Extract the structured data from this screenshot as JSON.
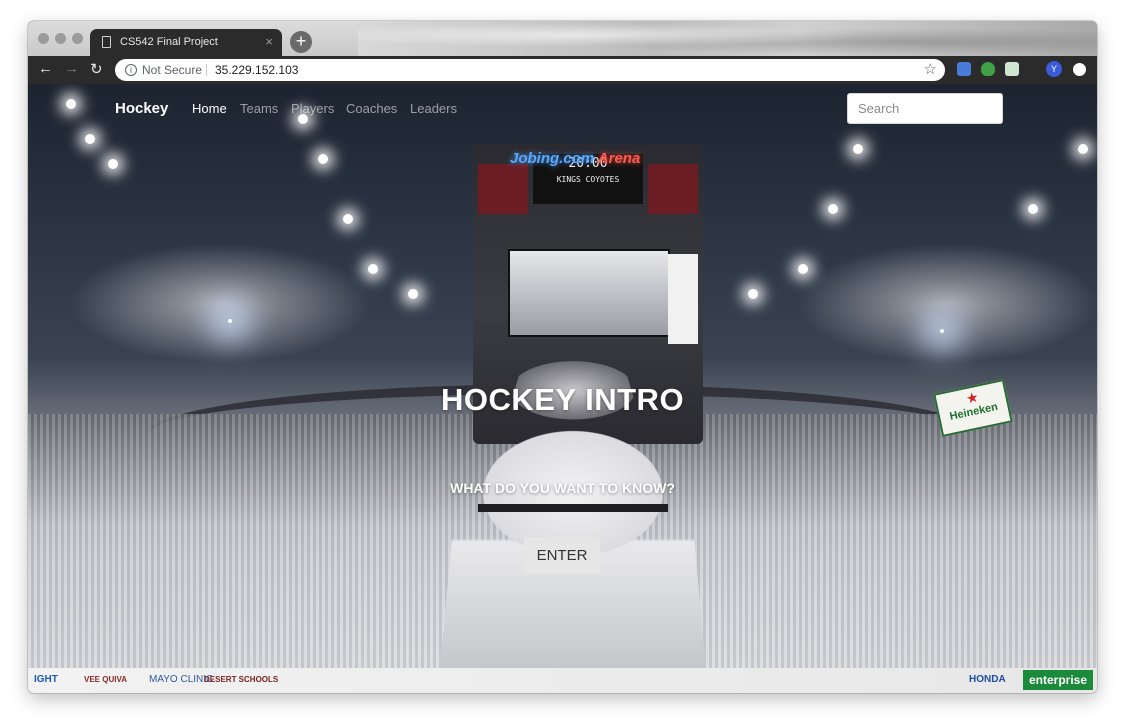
{
  "browser": {
    "tab_title": "CS542 Final Project",
    "tab_close": "×",
    "new_tab": "+",
    "security_label": "Not Secure",
    "url": "35.229.152.103",
    "profile_initial": "Y",
    "back": "←",
    "forward": "→",
    "reload": "↻",
    "bookmark": "☆"
  },
  "navbar": {
    "brand": "Hockey",
    "links": [
      {
        "label": "Home",
        "active": true
      },
      {
        "label": "Teams",
        "active": false
      },
      {
        "label": "Players",
        "active": false
      },
      {
        "label": "Coaches",
        "active": false
      },
      {
        "label": "Leaders",
        "active": false
      }
    ],
    "search_placeholder": "Search"
  },
  "hero": {
    "title": "HOCKEY INTRO",
    "subtitle": "WHAT DO YOU WANT TO KNOW?",
    "button_label": "ENTER"
  },
  "background": {
    "arena_sign": "Jobing.com",
    "arena_sign_suffix": "Arena",
    "scoreboard_clock": "20:00",
    "scoreboard_teams": "KINGS   COYOTES",
    "heineken": "Heineken",
    "board_ads": [
      "IGHT",
      "VEE QUIVA",
      "MAYO CLINIC",
      "DESERT SCHOOLS",
      "HONDA",
      "enterprise"
    ]
  }
}
